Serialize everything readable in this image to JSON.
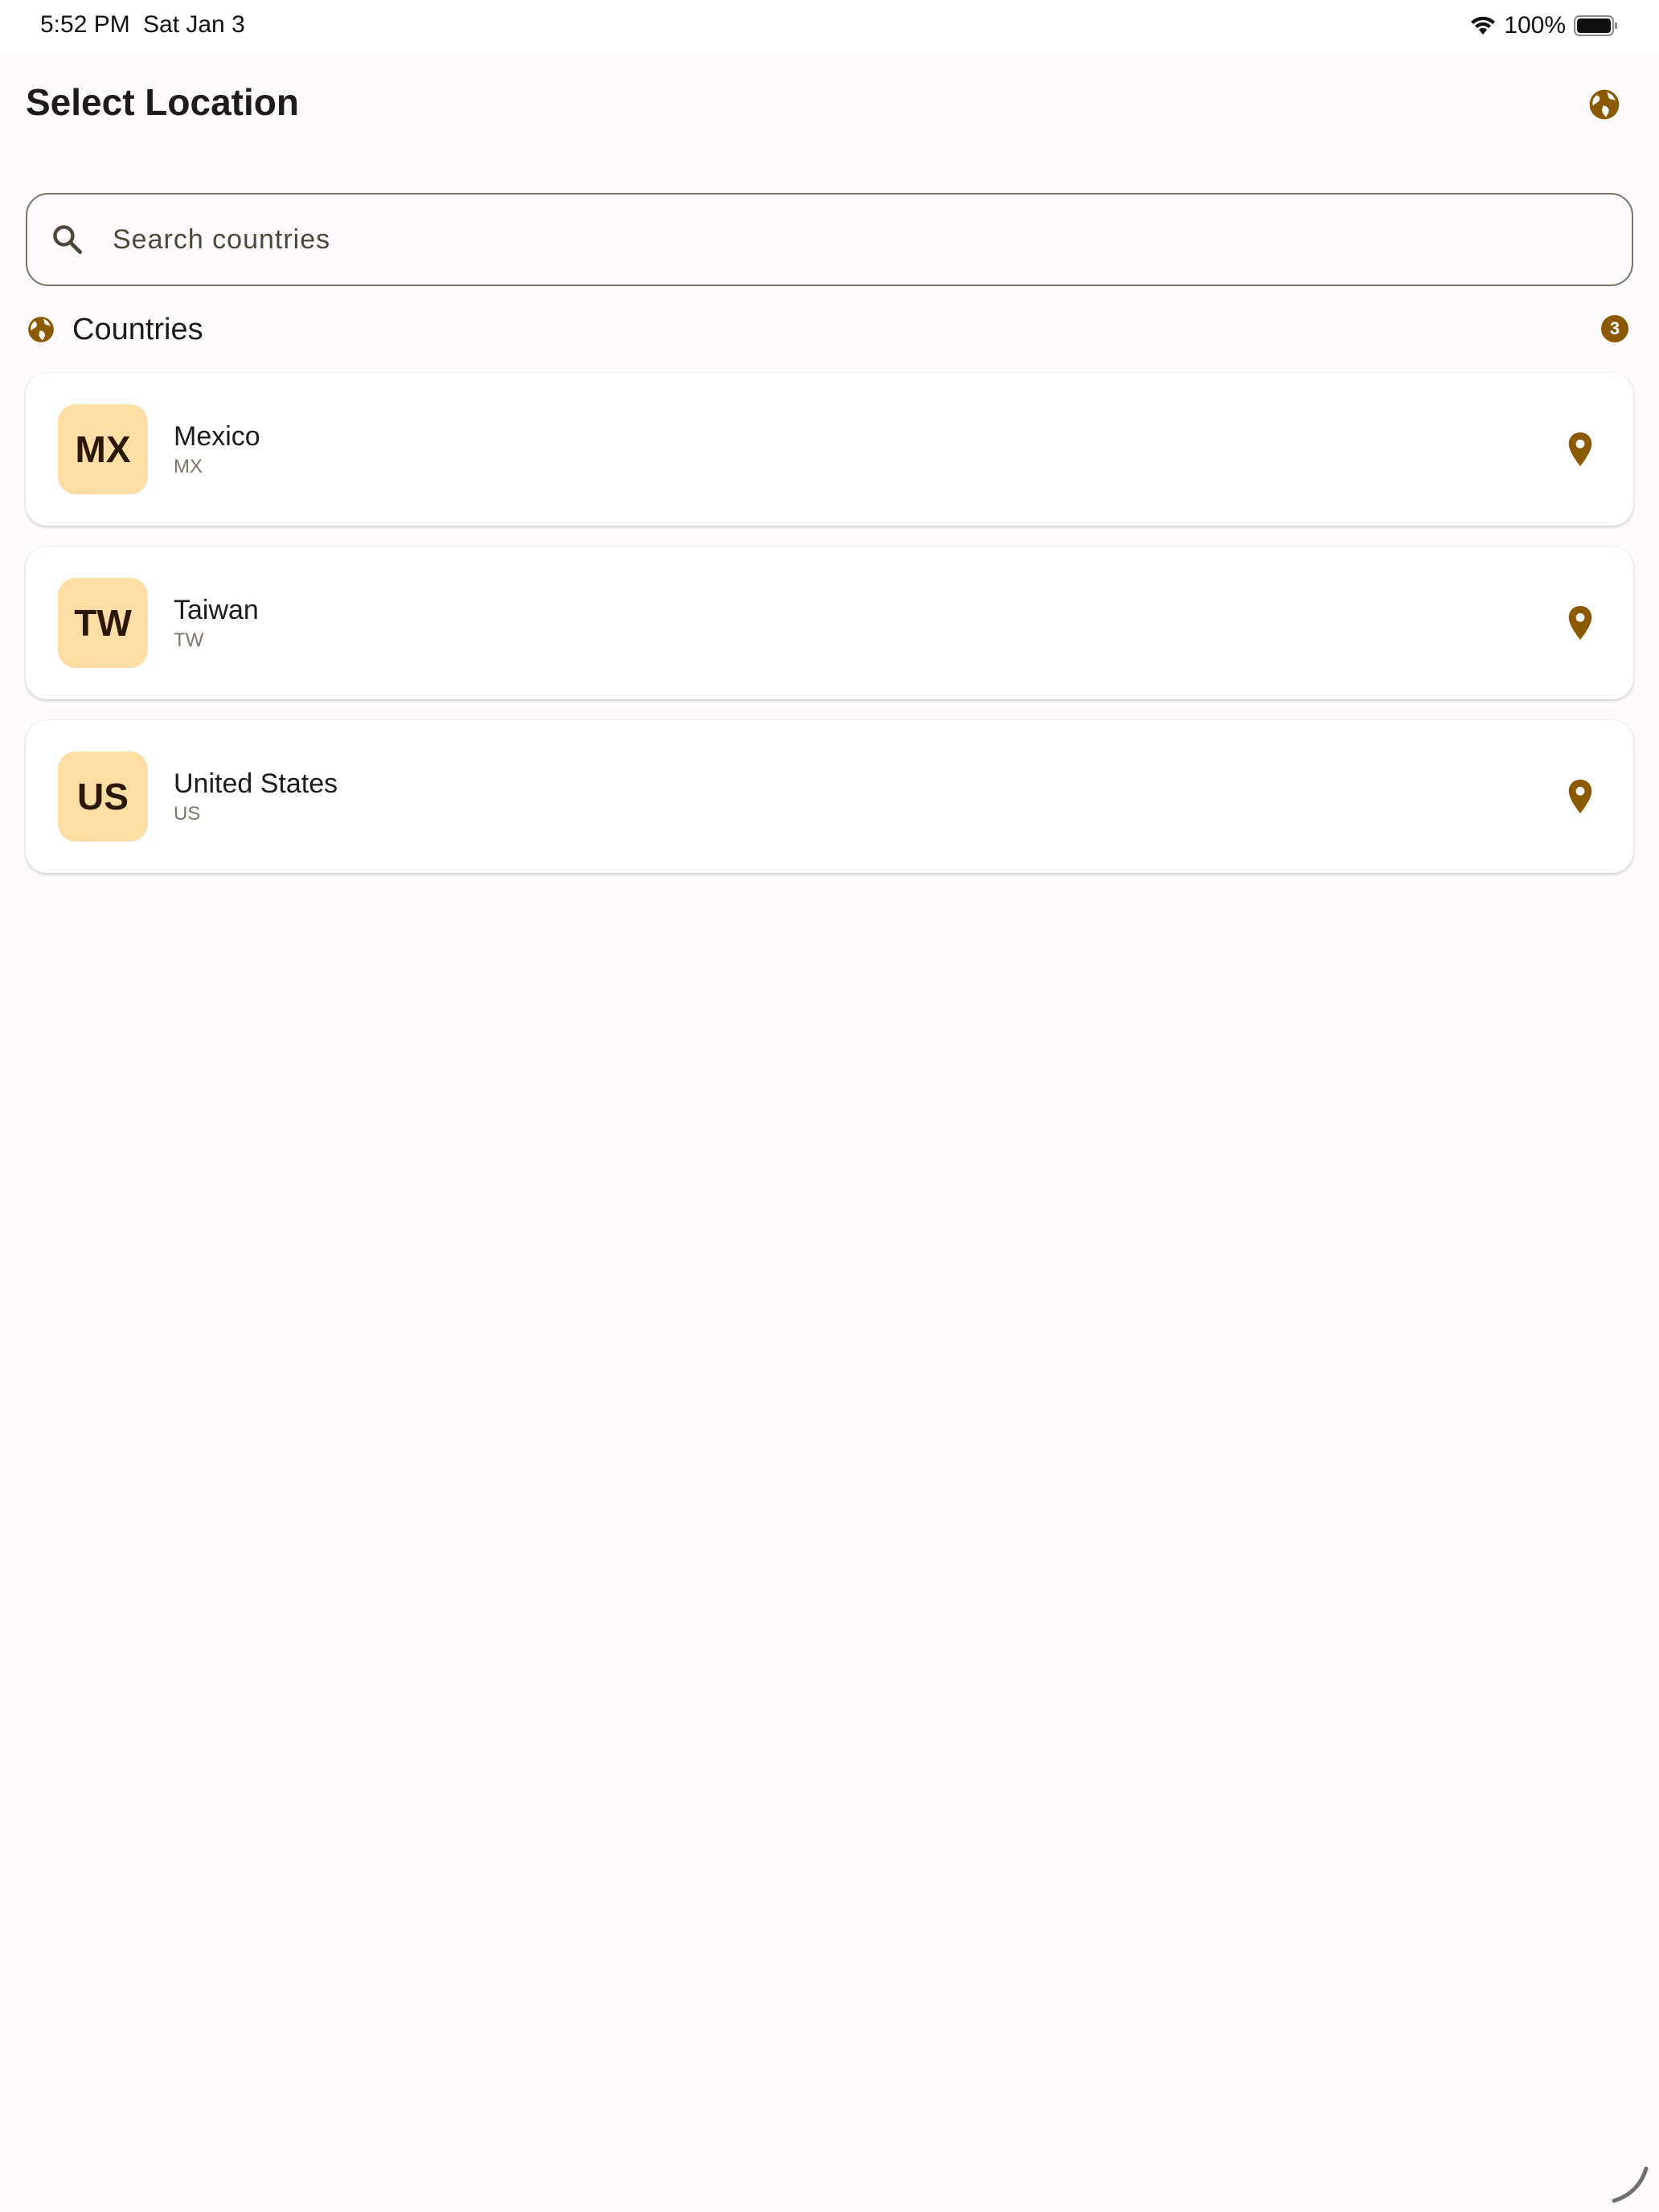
{
  "status_bar": {
    "time": "5:52 PM",
    "date": "Sat Jan 3",
    "battery": "100%"
  },
  "header": {
    "title": "Select Location",
    "action_icon": "globe-icon"
  },
  "search": {
    "placeholder": "Search countries",
    "value": ""
  },
  "section": {
    "title": "Countries",
    "count": "3"
  },
  "countries": [
    {
      "avatar": "MX",
      "name": "Mexico",
      "code": "MX"
    },
    {
      "avatar": "TW",
      "name": "Taiwan",
      "code": "TW"
    },
    {
      "avatar": "US",
      "name": "United States",
      "code": "US"
    }
  ],
  "colors": {
    "background": "#fefafd",
    "accent": "#8b5a00",
    "avatar_bg": "#ffdea6",
    "avatar_text": "#2a1800"
  }
}
